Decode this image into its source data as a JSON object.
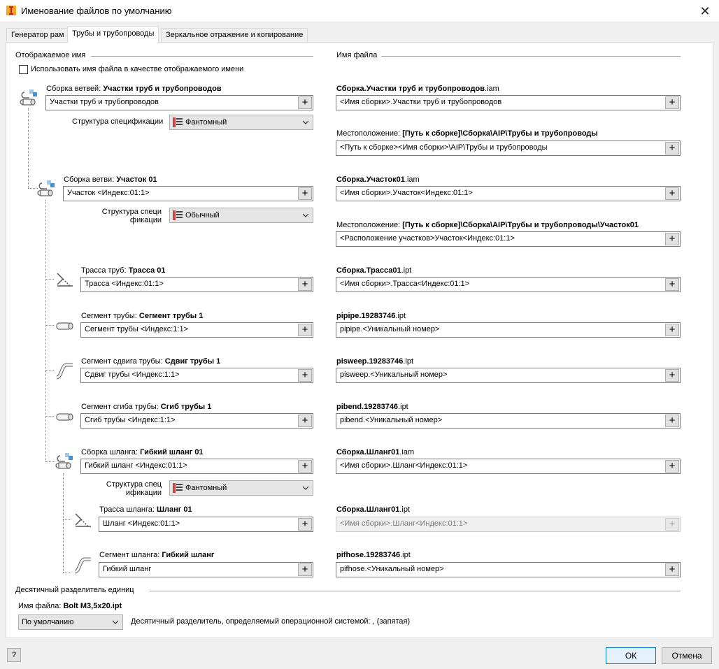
{
  "window": {
    "title": "Именование файлов по умолчанию"
  },
  "tabs": [
    {
      "label": "Генератор рам"
    },
    {
      "label": "Трубы и трубопроводы"
    },
    {
      "label": "Зеркальное отражение и копирование"
    }
  ],
  "display_name": {
    "header": "Отображаемое имя",
    "checkbox_label": "Использовать имя файла в качестве отображаемого имени",
    "checked": false
  },
  "file_name": {
    "header": "Имя файла"
  },
  "rows": {
    "branches": {
      "label_prefix": "Сборка ветвей: ",
      "label_bold": "Участки труб и трубопроводов",
      "value": "Участки труб и трубопроводов",
      "bom_label": "Структура спецификации",
      "bom_value": "Фантомный",
      "file_bold": "Сборка.Участки труб и трубопроводов",
      "file_ext": ".iam",
      "file_value": "<Имя сборки>.Участки труб и трубопроводов",
      "loc_prefix": "Местоположение: ",
      "loc_bold": "[Путь к сборке]\\Сборка\\AIP\\Трубы и трубопроводы",
      "loc_value": "<Путь к сборке><Имя сборки>\\AIP\\Трубы и трубопроводы"
    },
    "branch": {
      "label_prefix": "Сборка ветви: ",
      "label_bold": "Участок 01",
      "value": "Участок <Индекс:01:1>",
      "bom_label_1": "Структура специ",
      "bom_label_2": "фикации",
      "bom_value": "Обычный",
      "file_bold": "Сборка.Участок01",
      "file_ext": ".iam",
      "file_value": "<Имя сборки>.Участок<Индекс:01:1>",
      "loc_prefix": "Местоположение: ",
      "loc_bold": "[Путь к сборке]\\Сборка\\AIP\\Трубы и трубопроводы\\Участок01",
      "loc_value": "<Расположение участков>Участок<Индекс:01:1>"
    },
    "route": {
      "label_prefix": "Трасса труб: ",
      "label_bold": "Трасса 01",
      "value": "Трасса <Индекс:01:1>",
      "file_bold": "Сборка.Трасса01",
      "file_ext": ".ipt",
      "file_value": "<Имя сборки>.Трасса<Индекс:01:1>"
    },
    "segment": {
      "label_prefix": "Сегмент трубы: ",
      "label_bold": "Сегмент трубы 1",
      "value": "Сегмент трубы <Индекс:1:1>",
      "file_bold": "pipipe.19283746",
      "file_ext": ".ipt",
      "file_value": "pipipe.<Уникальный номер>"
    },
    "sweep": {
      "label_prefix": "Сегмент сдвига трубы: ",
      "label_bold": "Сдвиг трубы 1",
      "value": "Сдвиг трубы <Индекс:1:1>",
      "file_bold": "pisweep.19283746",
      "file_ext": ".ipt",
      "file_value": "pisweep.<Уникальный номер>"
    },
    "bend": {
      "label_prefix": "Сегмент сгиба трубы: ",
      "label_bold": "Сгиб трубы 1",
      "value": "Сгиб трубы <Индекс:1:1>",
      "file_bold": "pibend.19283746",
      "file_ext": ".ipt",
      "file_value": "pibend.<Уникальный номер>"
    },
    "hose_asm": {
      "label_prefix": "Сборка шланга: ",
      "label_bold": "Гибкий шланг 01",
      "value": "Гибкий шланг <Индекс:01:1>",
      "bom_label_1": "Структура спец",
      "bom_label_2": "ификации",
      "bom_value": "Фантомный",
      "file_bold": "Сборка.Шланг01",
      "file_ext": ".iam",
      "file_value": "<Имя сборки>.Шланг<Индекс:01:1>"
    },
    "hose_route": {
      "label_prefix": "Трасса шланга: ",
      "label_bold": "Шланг 01",
      "value": "Шланг <Индекс:01:1>",
      "file_bold": "Сборка.Шланг01",
      "file_ext": ".ipt",
      "file_value": "<Имя сборки>.Шланг<Индекс:01:1>"
    },
    "hose_seg": {
      "label_prefix": "Сегмент шланга: ",
      "label_bold": "Гибкий шланг",
      "value": "Гибкий шланг",
      "file_bold": "pifhose.19283746",
      "file_ext": ".ipt",
      "file_value": "pifhose.<Уникальный номер>"
    }
  },
  "plus": "+",
  "decimal": {
    "header": "Десятичный разделитель единиц",
    "file_prefix": "Имя файла: ",
    "file_bold": "Bolt M3,5x20.ipt",
    "select_value": "По умолчанию",
    "note": "Десятичный разделитель, определяемый операционной системой: , (запятая)"
  },
  "buttons": {
    "ok": "ОК",
    "cancel": "Отмена",
    "help": "?"
  },
  "icons": {
    "app": "inventor-icon",
    "close": "close-icon",
    "assembly": "pipe-assembly-icon",
    "route": "route-icon",
    "pipe": "pipe-segment-icon",
    "sweep": "sweep-icon",
    "bend": "bend-icon",
    "bom": "bom-structure-icon",
    "dropdown": "chevron-down-icon"
  }
}
